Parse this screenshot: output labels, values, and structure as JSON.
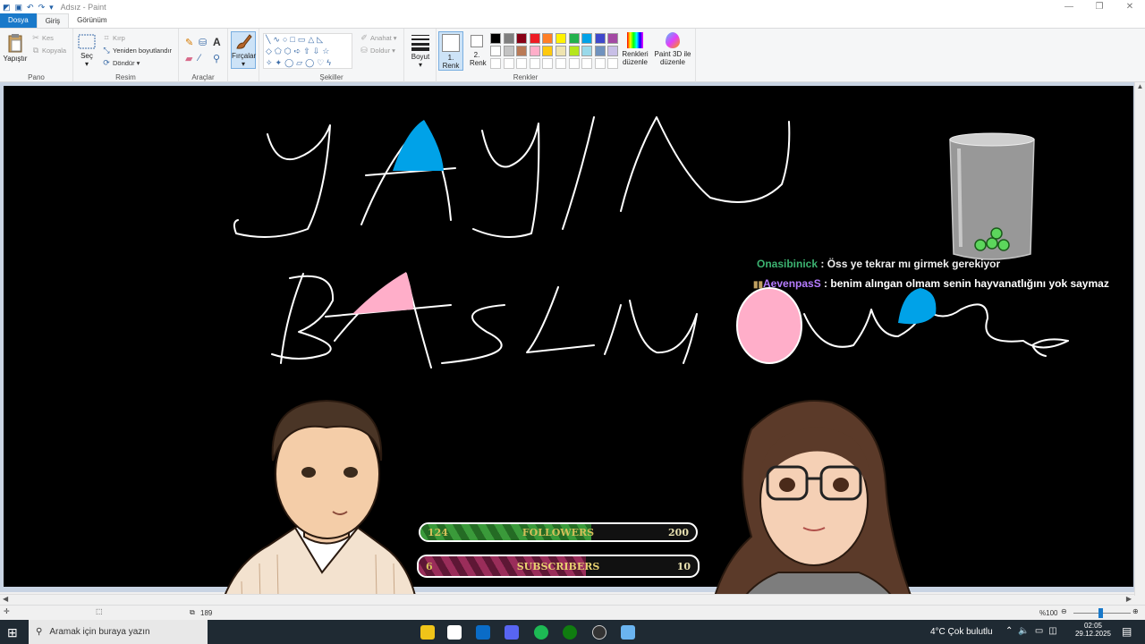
{
  "window": {
    "title": "Adsız - Paint"
  },
  "tabs": {
    "file": "Dosya",
    "home": "Giriş",
    "view": "Görünüm"
  },
  "ribbon": {
    "clipboard": {
      "label": "Pano",
      "paste": "Yapıştır",
      "cut": "Kes",
      "copy": "Kopyala"
    },
    "image": {
      "label": "Resim",
      "select": "Seç",
      "crop": "Kırp",
      "resize": "Yeniden boyutlandır",
      "rotate": "Döndür"
    },
    "tools": {
      "label": "Araçlar"
    },
    "brushes": {
      "label": "Fırçalar"
    },
    "shapes": {
      "label": "Şekiller",
      "outline": "Anahat",
      "fill": "Doldur"
    },
    "size": {
      "label": "Boyut"
    },
    "colors": {
      "label": "Renkler",
      "color1": "1. Renk",
      "color2": "2. Renk",
      "edit": "Renkleri düzenle",
      "paint3d": "Paint 3D ile düzenle",
      "palette_row1": [
        "#000000",
        "#7f7f7f",
        "#880015",
        "#ed1c24",
        "#ff7f27",
        "#fff200",
        "#22b14c",
        "#00a2e8",
        "#3f48cc",
        "#a349a4"
      ],
      "palette_row2": [
        "#ffffff",
        "#c3c3c3",
        "#b97a57",
        "#ffaec9",
        "#ffc90e",
        "#efe4b0",
        "#b5e61d",
        "#99d9ea",
        "#7092be",
        "#c8bfe7"
      ]
    }
  },
  "canvas_text": {
    "chat1_user": "Onasibinick",
    "chat1_msg": " : Öss ye tekrar mı girmek gerekiyor",
    "chat2_user": "AevenpasS",
    "chat2_msg": " : benim alıngan olmam senin hayvanatlığını yok saymaz"
  },
  "goals": {
    "followers": {
      "label": "FOLLOWERS",
      "current": "124",
      "target": "200",
      "progress": 0.62,
      "color": "#2e7d2e"
    },
    "subscribers": {
      "label": "SUBSCRIBERS",
      "current": "6",
      "target": "10",
      "progress": 0.6,
      "color": "#7a1f45"
    }
  },
  "status": {
    "size": "189",
    "zoom": "%100"
  },
  "taskbar": {
    "search": "Aramak için buraya yazın",
    "weather": "4°C  Çok bulutlu",
    "time": "02:05",
    "date": "29.12.2025"
  }
}
